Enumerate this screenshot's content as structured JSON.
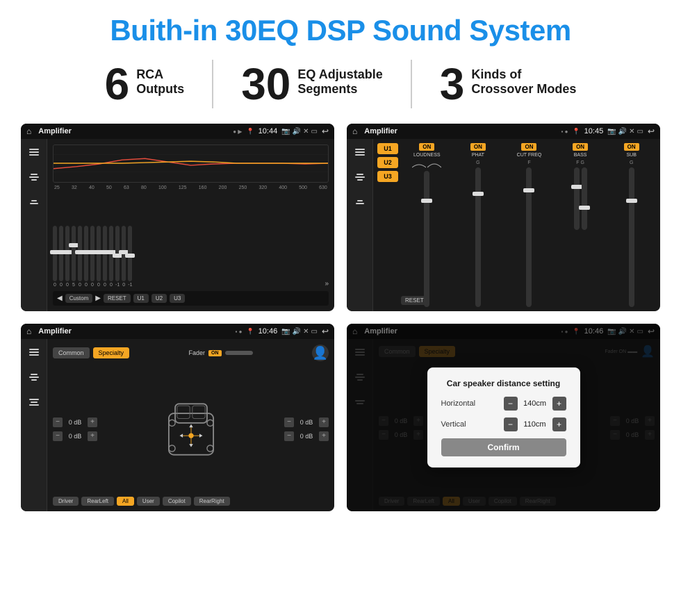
{
  "page": {
    "title": "Buith-in 30EQ DSP Sound System",
    "stats": [
      {
        "number": "6",
        "line1": "RCA",
        "line2": "Outputs"
      },
      {
        "number": "30",
        "line1": "EQ Adjustable",
        "line2": "Segments"
      },
      {
        "number": "3",
        "line1": "Kinds of",
        "line2": "Crossover Modes"
      }
    ]
  },
  "screen1": {
    "title": "Amplifier",
    "time": "10:44",
    "freq_labels": [
      "25",
      "32",
      "40",
      "50",
      "63",
      "80",
      "100",
      "125",
      "160",
      "200",
      "250",
      "320",
      "400",
      "500",
      "630"
    ],
    "sliders": [
      {
        "value": "0"
      },
      {
        "value": "0"
      },
      {
        "value": "0"
      },
      {
        "value": "5"
      },
      {
        "value": "0"
      },
      {
        "value": "0"
      },
      {
        "value": "0"
      },
      {
        "value": "0"
      },
      {
        "value": "0"
      },
      {
        "value": "0"
      },
      {
        "value": "-1"
      },
      {
        "value": "0"
      },
      {
        "value": "-1"
      }
    ],
    "buttons": [
      "Custom",
      "RESET",
      "U1",
      "U2",
      "U3"
    ]
  },
  "screen2": {
    "title": "Amplifier",
    "time": "10:45",
    "presets": [
      "U1",
      "U2",
      "U3"
    ],
    "controls": [
      {
        "on": true,
        "label": "LOUDNESS"
      },
      {
        "on": true,
        "label": "PHAT"
      },
      {
        "on": true,
        "label": "CUT FREQ"
      },
      {
        "on": true,
        "label": "BASS"
      },
      {
        "on": true,
        "label": "SUB"
      }
    ],
    "reset_label": "RESET"
  },
  "screen3": {
    "title": "Amplifier",
    "time": "10:46",
    "tabs": [
      "Common",
      "Specialty"
    ],
    "fader_label": "Fader",
    "fader_on": "ON",
    "db_values": [
      "0 dB",
      "0 dB",
      "0 dB",
      "0 dB"
    ],
    "bottom_btns": [
      "Driver",
      "RearLeft",
      "All",
      "User",
      "Copilot",
      "RearRight"
    ]
  },
  "screen4": {
    "title": "Amplifier",
    "time": "10:46",
    "tabs": [
      "Common",
      "Specialty"
    ],
    "dialog": {
      "title": "Car speaker distance setting",
      "horizontal_label": "Horizontal",
      "horizontal_value": "140cm",
      "vertical_label": "Vertical",
      "vertical_value": "110cm",
      "confirm_label": "Confirm"
    },
    "bottom_btns": [
      "Driver",
      "RearLeft",
      "All",
      "User",
      "Copilot",
      "RearRight"
    ],
    "db_values": [
      "0 dB",
      "0 dB"
    ]
  }
}
